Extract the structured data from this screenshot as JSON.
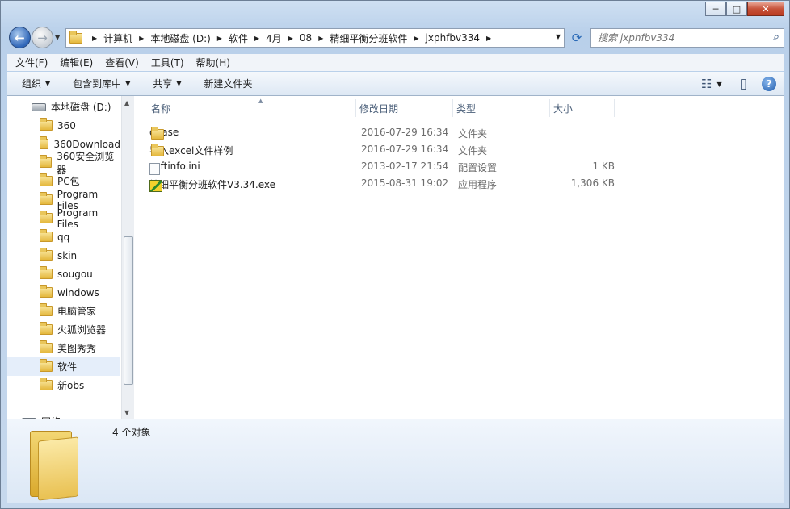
{
  "caption_buttons": {
    "minimize": "─",
    "maximize": "□",
    "close": "✕"
  },
  "nav": {
    "back_glyph": "←",
    "forward_glyph": "→",
    "history_glyph": "▼",
    "refresh_glyph": "⟳"
  },
  "breadcrumb": [
    {
      "label": "计算机"
    },
    {
      "label": "本地磁盘 (D:)"
    },
    {
      "label": "软件"
    },
    {
      "label": "4月"
    },
    {
      "label": "08"
    },
    {
      "label": "精细平衡分班软件"
    },
    {
      "label": "jxphfbv334"
    }
  ],
  "search": {
    "placeholder": "搜索 jxphfbv334",
    "icon": "magnifier-icon"
  },
  "menu": [
    "文件(F)",
    "编辑(E)",
    "查看(V)",
    "工具(T)",
    "帮助(H)"
  ],
  "commands": [
    {
      "label": "组织",
      "dropdown": true
    },
    {
      "label": "包含到库中",
      "dropdown": true
    },
    {
      "label": "共享",
      "dropdown": true
    },
    {
      "label": "新建文件夹",
      "dropdown": false
    }
  ],
  "view_controls": {
    "view_glyph": "☷",
    "dropdown_glyph": "▼",
    "preview_glyph": "▯",
    "help_glyph": "?"
  },
  "sidebar": {
    "drive": "本地磁盘 (D:)",
    "folders": [
      "360",
      "360Download",
      "360安全浏览器",
      "PC包",
      "Program Files",
      "Program Files",
      "qq",
      "skin",
      "sougou",
      "windows",
      "电脑管家",
      "火狐浏览器",
      "美图秀秀",
      "软件",
      "新obs"
    ],
    "selected": "软件",
    "partial_item": "网络"
  },
  "columns": {
    "name": "名称",
    "date": "修改日期",
    "type": "类型",
    "size": "大小"
  },
  "files": [
    {
      "name": "dbase",
      "date": "2016-07-29 16:34",
      "type": "文件夹",
      "size": "",
      "icon": "folder-icon"
    },
    {
      "name": "导入excel文件样例",
      "date": "2016-07-29 16:34",
      "type": "文件夹",
      "size": "",
      "icon": "folder-icon"
    },
    {
      "name": "softinfo.ini",
      "date": "2013-02-17 21:54",
      "type": "配置设置",
      "size": "1 KB",
      "icon": "ini-file-icon"
    },
    {
      "name": "精细平衡分班软件V3.34.exe",
      "date": "2015-08-31 19:02",
      "type": "应用程序",
      "size": "1,306 KB",
      "icon": "exe-file-icon"
    }
  ],
  "status": {
    "count_text": "4 个对象"
  }
}
